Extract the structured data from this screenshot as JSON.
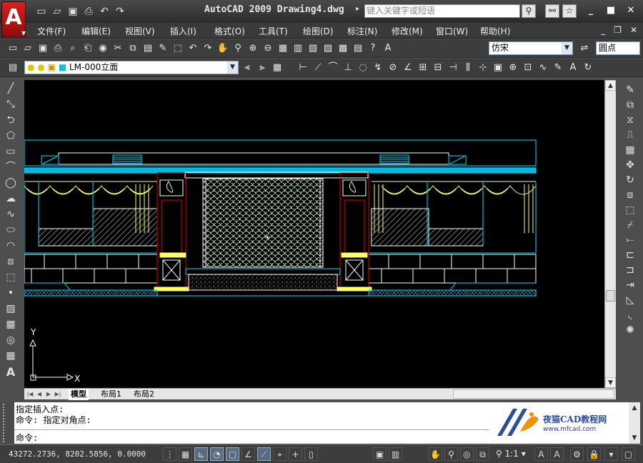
{
  "app": {
    "title": "AutoCAD 2009 Drawing4.dwg",
    "logo_letter": "A",
    "search_placeholder": "键入关键字或短语"
  },
  "window": {
    "minimize": "_",
    "maximize": "■",
    "close": "✕"
  },
  "document_buttons": {
    "minimize": "_",
    "restore": "❐",
    "close": "✕"
  },
  "menus": [
    "文件(F)",
    "编辑(E)",
    "视图(V)",
    "插入(I)",
    "格式(O)",
    "工具(T)",
    "绘图(D)",
    "标注(N)",
    "修改(M)",
    "窗口(W)",
    "帮助(H)"
  ],
  "toolbars": {
    "text_style_value": "仿宋",
    "dim_style_value": "圆点",
    "layer_value": "LM-000立面"
  },
  "canvas": {
    "ucs_x_label": "X",
    "ucs_y_label": "Y"
  },
  "layout_tabs": [
    "模型",
    "布局1",
    "布局2"
  ],
  "command": {
    "history": [
      "指定插入点:",
      "命令: 指定对角点:"
    ],
    "prompt": "命令:"
  },
  "watermark": {
    "brand": "夜猫CAD教程网",
    "url": "www.mfcad.com"
  },
  "status": {
    "coordinates": "43272.2736, 8202.5856, 0.0000",
    "annotation_scale": "1:1"
  },
  "colors": {
    "canvas_bg": "#000000",
    "cyan": "#00d8ff",
    "yellow": "#ffff66",
    "red": "#e00000",
    "green_white": "#cfffd0"
  }
}
